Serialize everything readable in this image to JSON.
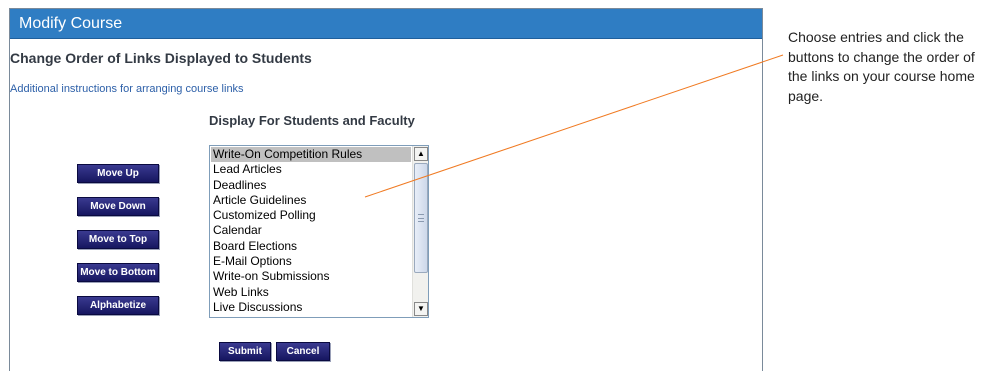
{
  "window": {
    "title": "Modify Course"
  },
  "page": {
    "heading": "Change Order of Links Displayed to Students",
    "instructions_link": "Additional instructions for arranging course links",
    "section_heading": "Display For Students and Faculty"
  },
  "buttons": {
    "move_up": "Move Up",
    "move_down": "Move Down",
    "move_to_top": "Move to Top",
    "move_to_bottom": "Move to Bottom",
    "alphabetize": "Alphabetize",
    "submit": "Submit",
    "cancel": "Cancel"
  },
  "links_list": {
    "selected_index": 0,
    "items": [
      "Write-On Competition Rules",
      "Lead Articles",
      "Deadlines",
      "Article Guidelines",
      "Customized Polling",
      "Calendar",
      "Board Elections",
      "E-Mail Options",
      "Write-on Submissions",
      "Web Links",
      "Live Discussions"
    ]
  },
  "callout": {
    "text": "Choose entries and click the buttons to change the order of the links on your course home page.",
    "line_color": "#f07a22"
  },
  "colors": {
    "titlebar": "#2f7dc3",
    "button": "#1e1e6e",
    "link": "#2c5fa8"
  }
}
